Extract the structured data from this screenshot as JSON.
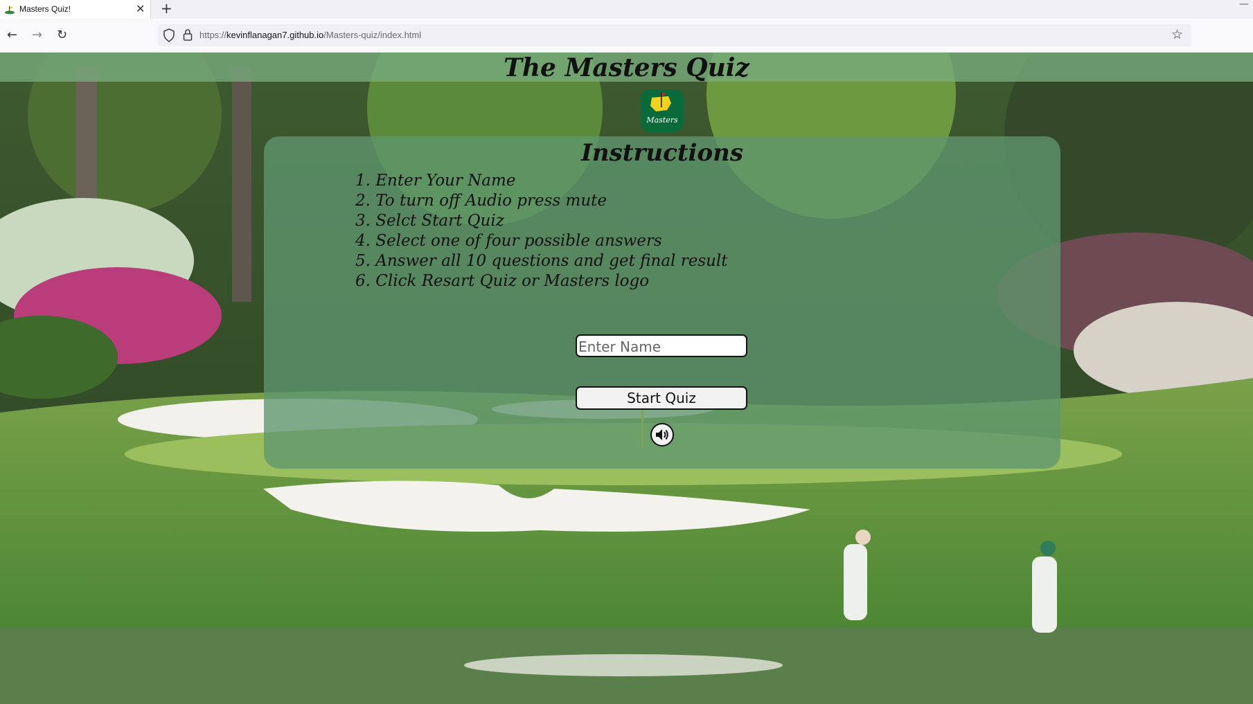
{
  "browser": {
    "tab_title": "Masters Quiz!",
    "tab_close": "✕",
    "new_tab": "+",
    "url_prefix": "https://",
    "url_host": "kevinflanagan7.github.io",
    "url_path": "/Masters-quiz/index.html",
    "icons": {
      "back": "←",
      "forward": "→",
      "reload": "↻",
      "bookmark": "☆",
      "minimize": "—"
    }
  },
  "page": {
    "title": "The Masters Quiz",
    "logo_text": "Masters",
    "instructions_title": "Instructions",
    "steps": [
      "1. Enter Your Name",
      "2. To turn off Audio press mute",
      "3. Selct Start Quiz",
      "4. Select one of four possible answers",
      "5. Answer all 10 questions and get final result",
      "6. Click Resart Quiz or Masters logo"
    ],
    "name_placeholder": "Enter Name",
    "start_label": "Start Quiz"
  },
  "colors": {
    "panel": "#5f966e",
    "header_band": "#78aa7d",
    "logo_bg": "#0a6b3a"
  }
}
